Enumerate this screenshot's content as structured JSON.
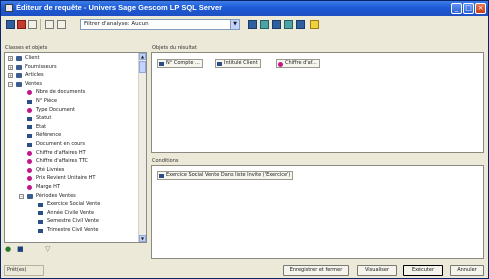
{
  "window": {
    "title": "Éditeur de requête - Univers Sage Gescom LP SQL Server",
    "minimize_glyph": "_",
    "maximize_glyph": "□",
    "close_glyph": "×"
  },
  "toolbar": {
    "filter_select_value": "Filtrer d'analyse: Aucun",
    "filter_select_arrow": "▼",
    "icons": [
      "query-icon",
      "refresh-icon",
      "view-icon",
      "filter-icon",
      "sort-icon",
      "sort-toggle-icon",
      "data-icon",
      "sql-icon",
      "options-icon",
      "help-icon"
    ]
  },
  "labels": {
    "classes_and_objects": "Classes et objets",
    "result_objects": "Objets du résultat",
    "conditions": "Conditions"
  },
  "tree": {
    "items": [
      {
        "label": "Client",
        "level": 0,
        "type": "folder",
        "expander": "+"
      },
      {
        "label": "Fournisseurs",
        "level": 0,
        "type": "folder",
        "expander": "+"
      },
      {
        "label": "Articles",
        "level": 0,
        "type": "folder",
        "expander": "+"
      },
      {
        "label": "Ventes",
        "level": 0,
        "type": "folder",
        "expander": "−"
      },
      {
        "label": "Nbre de documents",
        "level": 1,
        "type": "calc"
      },
      {
        "label": "N° Pièce",
        "level": 1,
        "type": "field"
      },
      {
        "label": "Type Document",
        "level": 1,
        "type": "calc"
      },
      {
        "label": "Statut",
        "level": 1,
        "type": "field"
      },
      {
        "label": "Etat",
        "level": 1,
        "type": "field"
      },
      {
        "label": "Référence",
        "level": 1,
        "type": "field"
      },
      {
        "label": "Document en cours",
        "level": 1,
        "type": "field"
      },
      {
        "label": "Chiffre d'affaires HT",
        "level": 1,
        "type": "calc"
      },
      {
        "label": "Chiffre d'affaires TTC",
        "level": 1,
        "type": "calc"
      },
      {
        "label": "Qté Livrées",
        "level": 1,
        "type": "calc"
      },
      {
        "label": "Prix Revient Unitaire HT",
        "level": 1,
        "type": "calc"
      },
      {
        "label": "Marge HT",
        "level": 1,
        "type": "calc"
      },
      {
        "label": "Périodes Ventes",
        "level": 1,
        "type": "folder",
        "expander": "−"
      },
      {
        "label": "Exercice Social Vente",
        "level": 2,
        "type": "field"
      },
      {
        "label": "Année Civile Vente",
        "level": 2,
        "type": "field"
      },
      {
        "label": "Semestre Civil Vente",
        "level": 2,
        "type": "field"
      },
      {
        "label": "Trimestre Civil Vente",
        "level": 2,
        "type": "field"
      }
    ],
    "scroll_up": "▲",
    "scroll_down": "▼"
  },
  "results": {
    "chips": [
      {
        "label": "N° Compte ...",
        "icon": "field"
      },
      {
        "label": "Intitulé Client",
        "icon": "field"
      },
      {
        "label": "Chiffre d'af...",
        "icon": "calc"
      }
    ]
  },
  "conditions": {
    "items": [
      {
        "label": "Exercice Social Vente Dans liste Invite ('Exercice')",
        "icon": "field"
      }
    ]
  },
  "status": {
    "text": "Prêt(es)"
  },
  "buttons": {
    "save_and_close": "Enregistrer et fermer",
    "view": "Visualiser",
    "execute": "Exécuter",
    "cancel": "Annuler"
  },
  "colors": {
    "titlebar": "#1c5ad6",
    "field_icon": "#2a4f86",
    "calc_icon": "#c2188a",
    "window_bg": "#ece9d8"
  }
}
